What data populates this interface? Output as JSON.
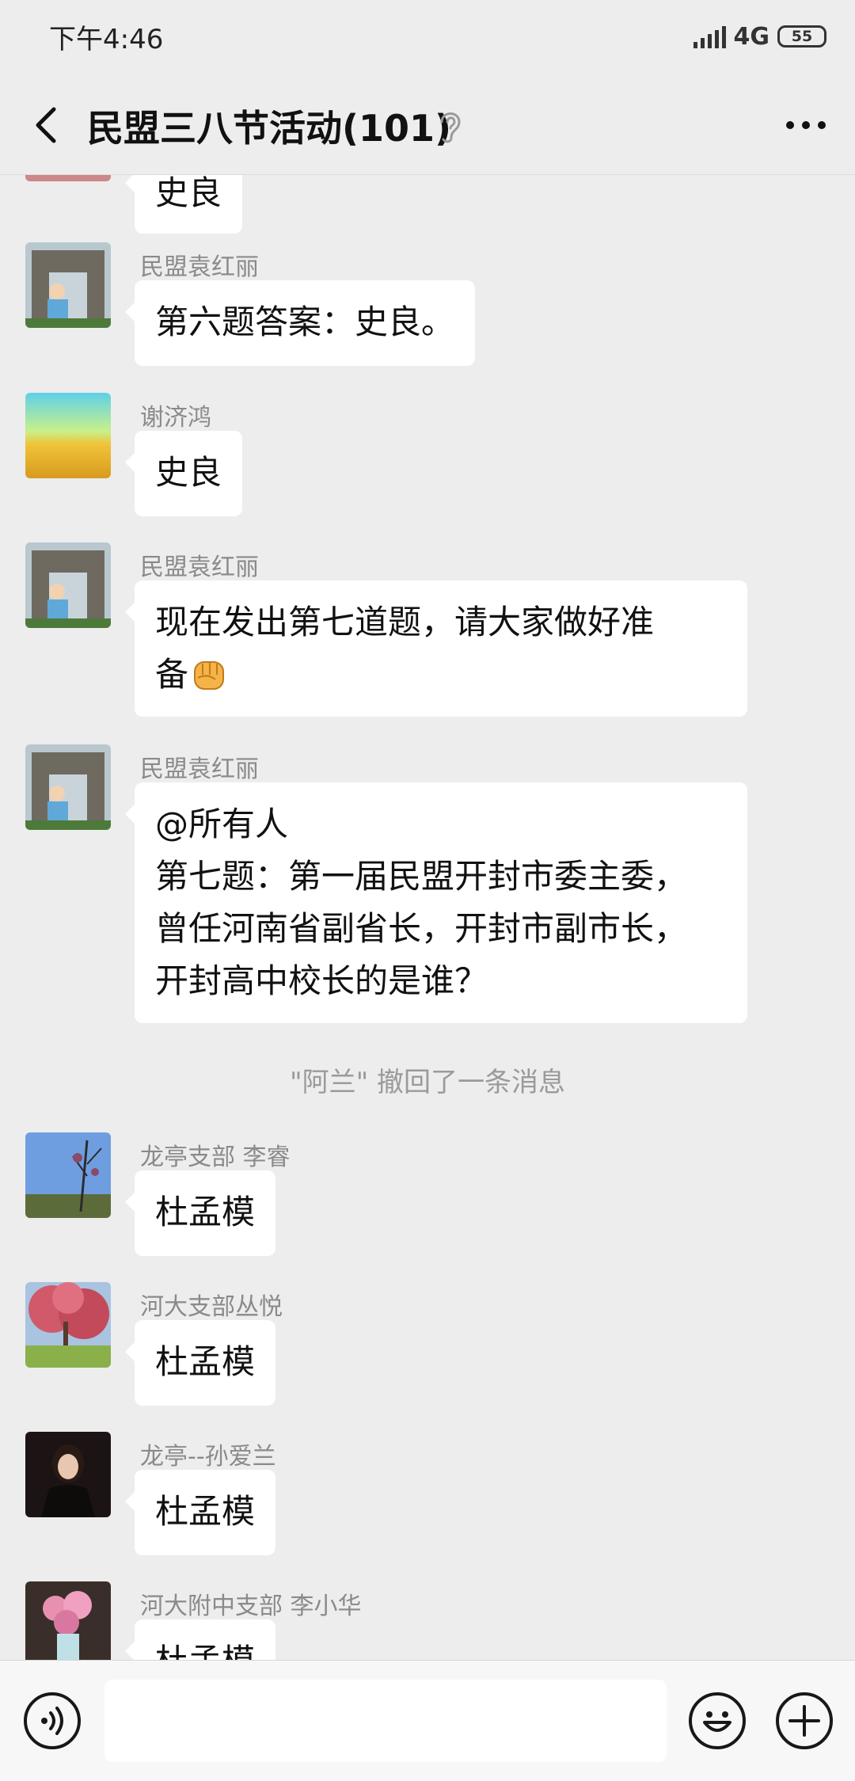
{
  "status_bar": {
    "time": "下午4:46",
    "network": "4G",
    "battery": "55"
  },
  "header": {
    "title": "民盟三八节活动(101)",
    "back_icon": "back-chevron-icon",
    "ear_icon": "ear-icon",
    "more_icon": "more-dots-icon"
  },
  "messages": [
    {
      "text": "史良"
    },
    {
      "sender": "民盟袁红丽",
      "text": "第六题答案：史良。"
    },
    {
      "sender": "谢济鸿",
      "text": "史良"
    },
    {
      "sender": "民盟袁红丽",
      "line1": "现在发出第七道题，请大家做好准",
      "line2": "备",
      "emoji": "raised-fist-emoji"
    },
    {
      "sender": "民盟袁红丽",
      "lines": [
        "@所有人",
        "第七题：第一届民盟开封市委主委，",
        "曾任河南省副省长，开封市副市长，",
        "开封高中校长的是谁？"
      ]
    },
    {
      "system": "\"阿兰\" 撤回了一条消息"
    },
    {
      "sender": "龙亭支部  李睿",
      "text": "杜孟模"
    },
    {
      "sender": "河大支部丛悦",
      "text": "杜孟模"
    },
    {
      "sender": "龙亭--孙爱兰",
      "text": "杜孟模"
    },
    {
      "sender": "河大附中支部  李小华",
      "text": "杜孟模"
    }
  ],
  "input_bar": {
    "placeholder": "",
    "voice_icon": "voice-icon",
    "emoji_icon": "emoji-icon",
    "plus_icon": "plus-icon"
  },
  "colors": {
    "background": "#ededed",
    "bubble": "#ffffff",
    "sender_name": "#8a8a8a"
  }
}
